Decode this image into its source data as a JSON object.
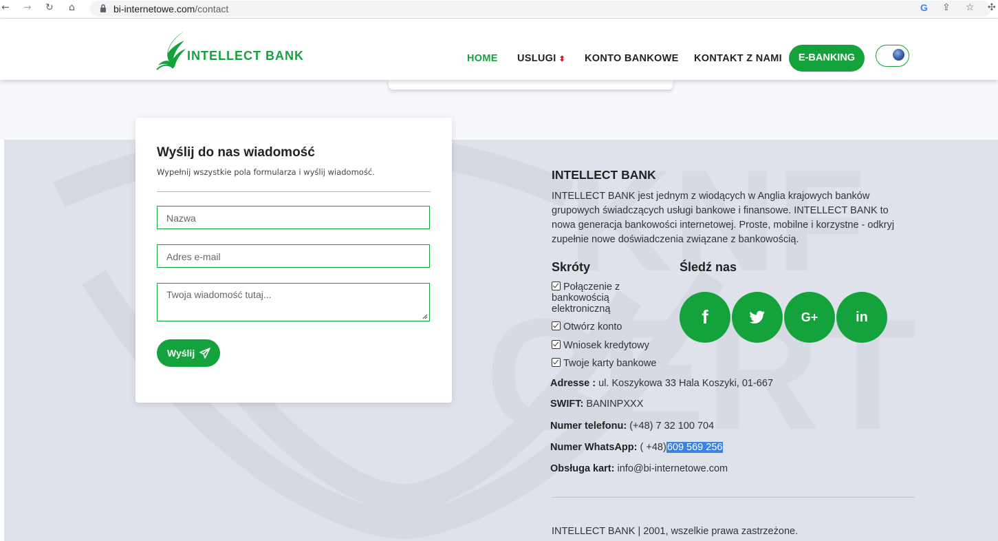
{
  "browser": {
    "url_domain": "bi-internetowe.com",
    "url_path": "/contact"
  },
  "header": {
    "logo_text": "INTELLECT BANK",
    "menu": {
      "home": "HOME",
      "services": "USLUGI",
      "account": "KONTO BANKOWE",
      "contact": "KONTAKT Z NAMI"
    },
    "ebanking": "E-BANKING"
  },
  "form": {
    "title": "Wyślij do nas wiadomość",
    "subtitle": "Wypełnij wszystkie pola formularza i wyślij wiadomość.",
    "name_placeholder": "Nazwa",
    "email_placeholder": "Adres e-mail",
    "message_placeholder": "Twoja wiadomość tutaj...",
    "send_label": "Wyślij"
  },
  "footer": {
    "title": "INTELLECT BANK",
    "description": "INTELLECT BANK jest jednym z wiodących w Anglia krajowych banków grupowych świadczących usługi bankowe i finansowe. INTELLECT BANK to nowa generacja bankowości internetowej. Proste, mobilne i korzystne - odkryj zupełnie nowe doświadczenia związane z bankowością.",
    "shortcuts_title": "Skróty",
    "shortcuts": [
      "Połączenie z bankowością elektroniczną",
      "Otwórz konto",
      "Wniosek kredytowy",
      "Twoje karty bankowe"
    ],
    "follow_title": "Śledź nas",
    "social": [
      "facebook",
      "twitter",
      "google-plus",
      "linkedin"
    ],
    "address_label": "Adresse :",
    "address_value": "ul. Koszykowa 33 Hala Koszyki, 01-667",
    "swift_label": "SWIFT:",
    "swift_value": "BANINPXXX",
    "phone_label": "Numer telefonu:",
    "phone_value": "(+48) 7 32 100 704",
    "whatsapp_label": "Numer WhatsApp:",
    "whatsapp_prefix": "( +48)",
    "whatsapp_number": "609 569 256",
    "cards_label": "Obsługa kart:",
    "cards_value": "info@bi-internetowe.com",
    "copyright": "INTELLECT BANK | 2001, wszelkie prawa zastrzeżone."
  },
  "colors": {
    "brand_green": "#14a23c",
    "footer_bg": "#dfe2ea",
    "selection_blue": "#3b82e6"
  }
}
